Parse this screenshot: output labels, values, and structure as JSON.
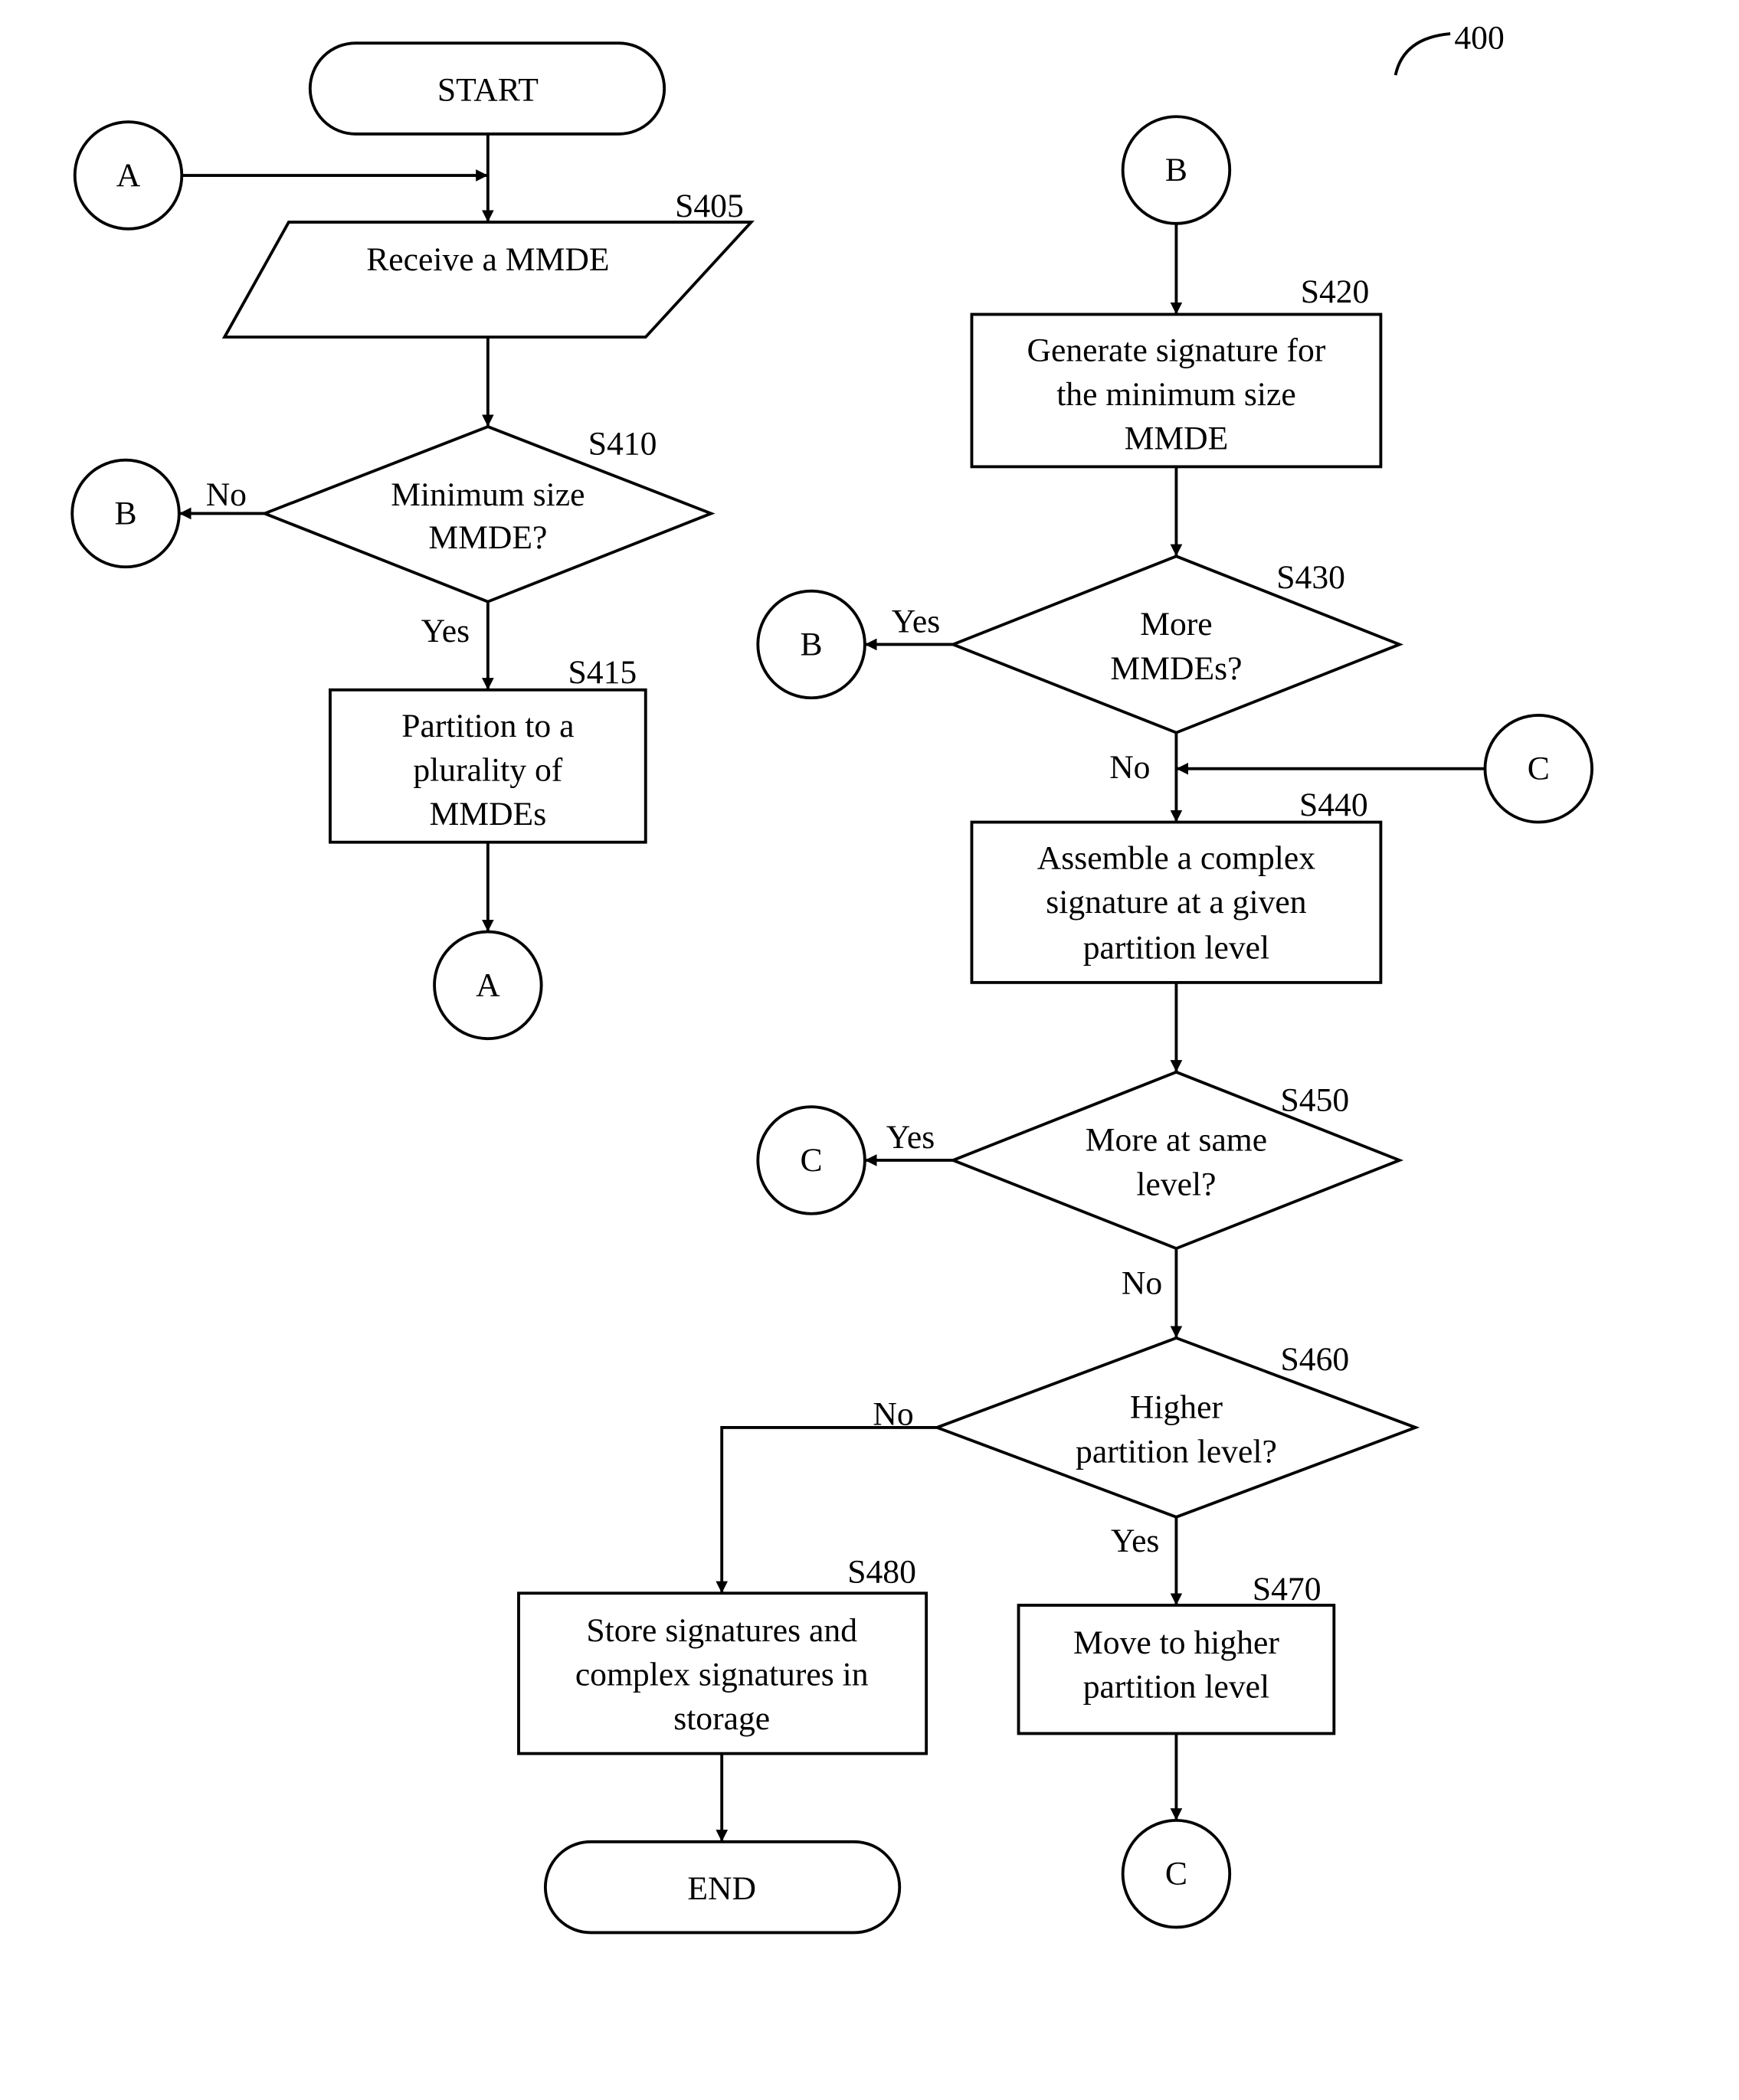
{
  "figure": {
    "reference_number": "400",
    "colors": {
      "stroke": "#000000",
      "background": "#ffffff"
    }
  },
  "terminals": {
    "start": "START",
    "end": "END"
  },
  "connectors": {
    "A_in": "A",
    "A_out": "A",
    "B_left": "B",
    "B_top": "B",
    "B_s430": "B",
    "C_in": "C",
    "C_s450": "C",
    "C_out": "C"
  },
  "steps": {
    "S405": {
      "id": "S405",
      "lines": [
        "Receive a MMDE"
      ]
    },
    "S410": {
      "id": "S410",
      "lines": [
        "Minimum size",
        "MMDE?"
      ]
    },
    "S415": {
      "id": "S415",
      "lines": [
        "Partition to a",
        "plurality of",
        "MMDEs"
      ]
    },
    "S420": {
      "id": "S420",
      "lines": [
        "Generate signature for",
        "the minimum size",
        "MMDE"
      ]
    },
    "S430": {
      "id": "S430",
      "lines": [
        "More",
        "MMDEs?"
      ]
    },
    "S440": {
      "id": "S440",
      "lines": [
        "Assemble a complex",
        "signature at a given",
        "partition level"
      ]
    },
    "S450": {
      "id": "S450",
      "lines": [
        "More at same",
        "level?"
      ]
    },
    "S460": {
      "id": "S460",
      "lines": [
        "Higher",
        "partition level?"
      ]
    },
    "S470": {
      "id": "S470",
      "lines": [
        "Move to higher",
        "partition level"
      ]
    },
    "S480": {
      "id": "S480",
      "lines": [
        "Store signatures and",
        "complex signatures in",
        "storage"
      ]
    }
  },
  "edge_labels": {
    "s410_no": "No",
    "s410_yes": "Yes",
    "s430_yes": "Yes",
    "s430_no": "No",
    "s450_yes": "Yes",
    "s450_no": "No",
    "s460_no": "No",
    "s460_yes": "Yes"
  }
}
